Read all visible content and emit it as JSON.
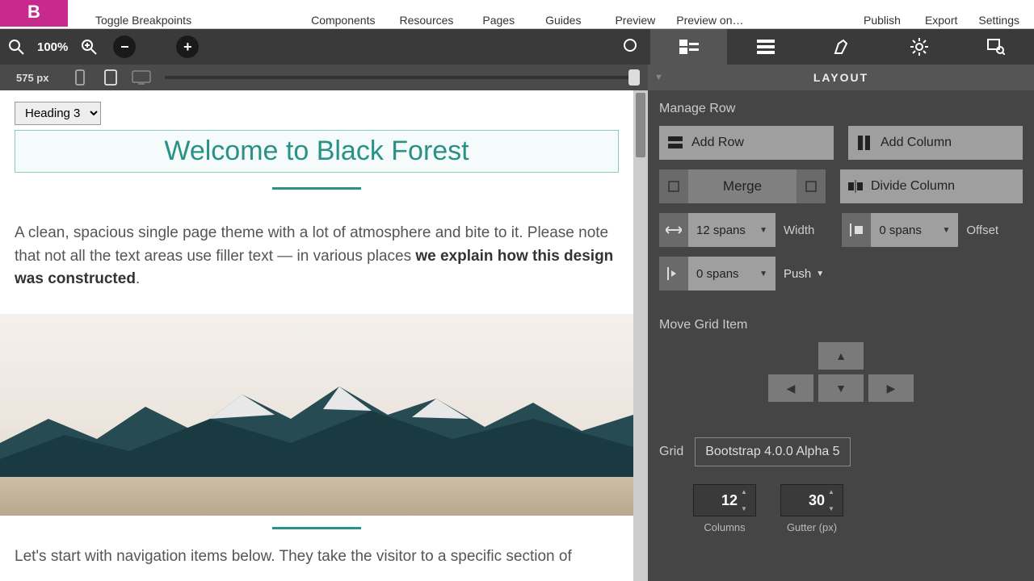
{
  "toolbar": {
    "toggle_breakpoints": "Toggle Breakpoints",
    "components": "Components",
    "resources": "Resources",
    "pages": "Pages",
    "guides": "Guides",
    "preview": "Preview",
    "preview_on": "Preview on…",
    "publish": "Publish",
    "export": "Export",
    "settings": "Settings"
  },
  "zoom": {
    "level": "100%"
  },
  "breakpoint": {
    "size": "575 px"
  },
  "right_panel_header": "LAYOUT",
  "canvas": {
    "heading_style": "Heading 3",
    "title": "Welcome to Black Forest",
    "paragraph1_a": "A clean, spacious single page theme with a lot of atmosphere and bite to it. Please note that not all the text areas use filler text — in various places ",
    "paragraph1_b": "we explain how this design was constructed",
    "paragraph1_c": ".",
    "paragraph2": "Let's start with navigation items below. They take the visitor to a specific section of"
  },
  "panel": {
    "manage_row": "Manage Row",
    "add_row": "Add Row",
    "add_column": "Add Column",
    "merge": "Merge",
    "divide_column": "Divide Column",
    "width_value": "12 spans",
    "width_label": "Width",
    "offset_value": "0 spans",
    "offset_label": "Offset",
    "push_value": "0 spans",
    "push_label": "Push",
    "move_grid_item": "Move Grid Item",
    "grid_label": "Grid",
    "grid_value": "Bootstrap 4.0.0 Alpha 5",
    "columns_value": "12",
    "columns_label": "Columns",
    "gutter_value": "30",
    "gutter_label": "Gutter (px)"
  }
}
